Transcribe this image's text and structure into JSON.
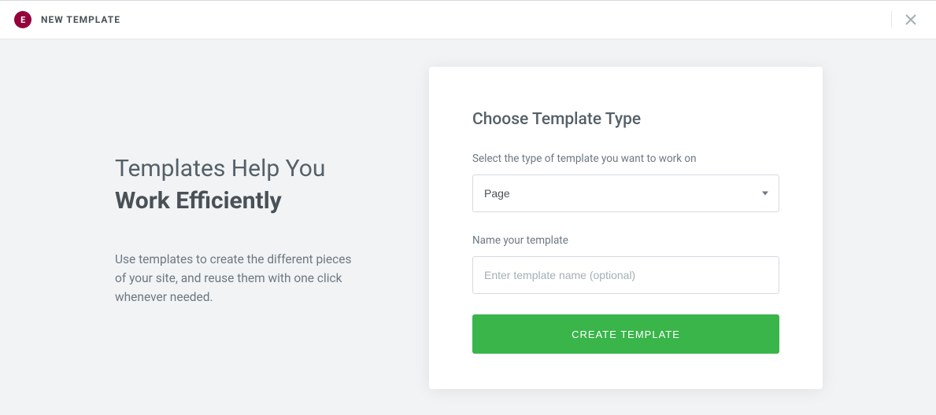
{
  "topbar": {
    "logo_text": "E",
    "title": "NEW TEMPLATE"
  },
  "intro": {
    "heading_line1": "Templates Help You",
    "heading_line2": "Work Efficiently",
    "description": "Use templates to create the different pieces of your site, and reuse them with one click whenever needed."
  },
  "form": {
    "title": "Choose Template Type",
    "type_label": "Select the type of template you want to work on",
    "type_value": "Page",
    "name_label": "Name your template",
    "name_placeholder": "Enter template name (optional)",
    "submit_label": "CREATE TEMPLATE"
  }
}
